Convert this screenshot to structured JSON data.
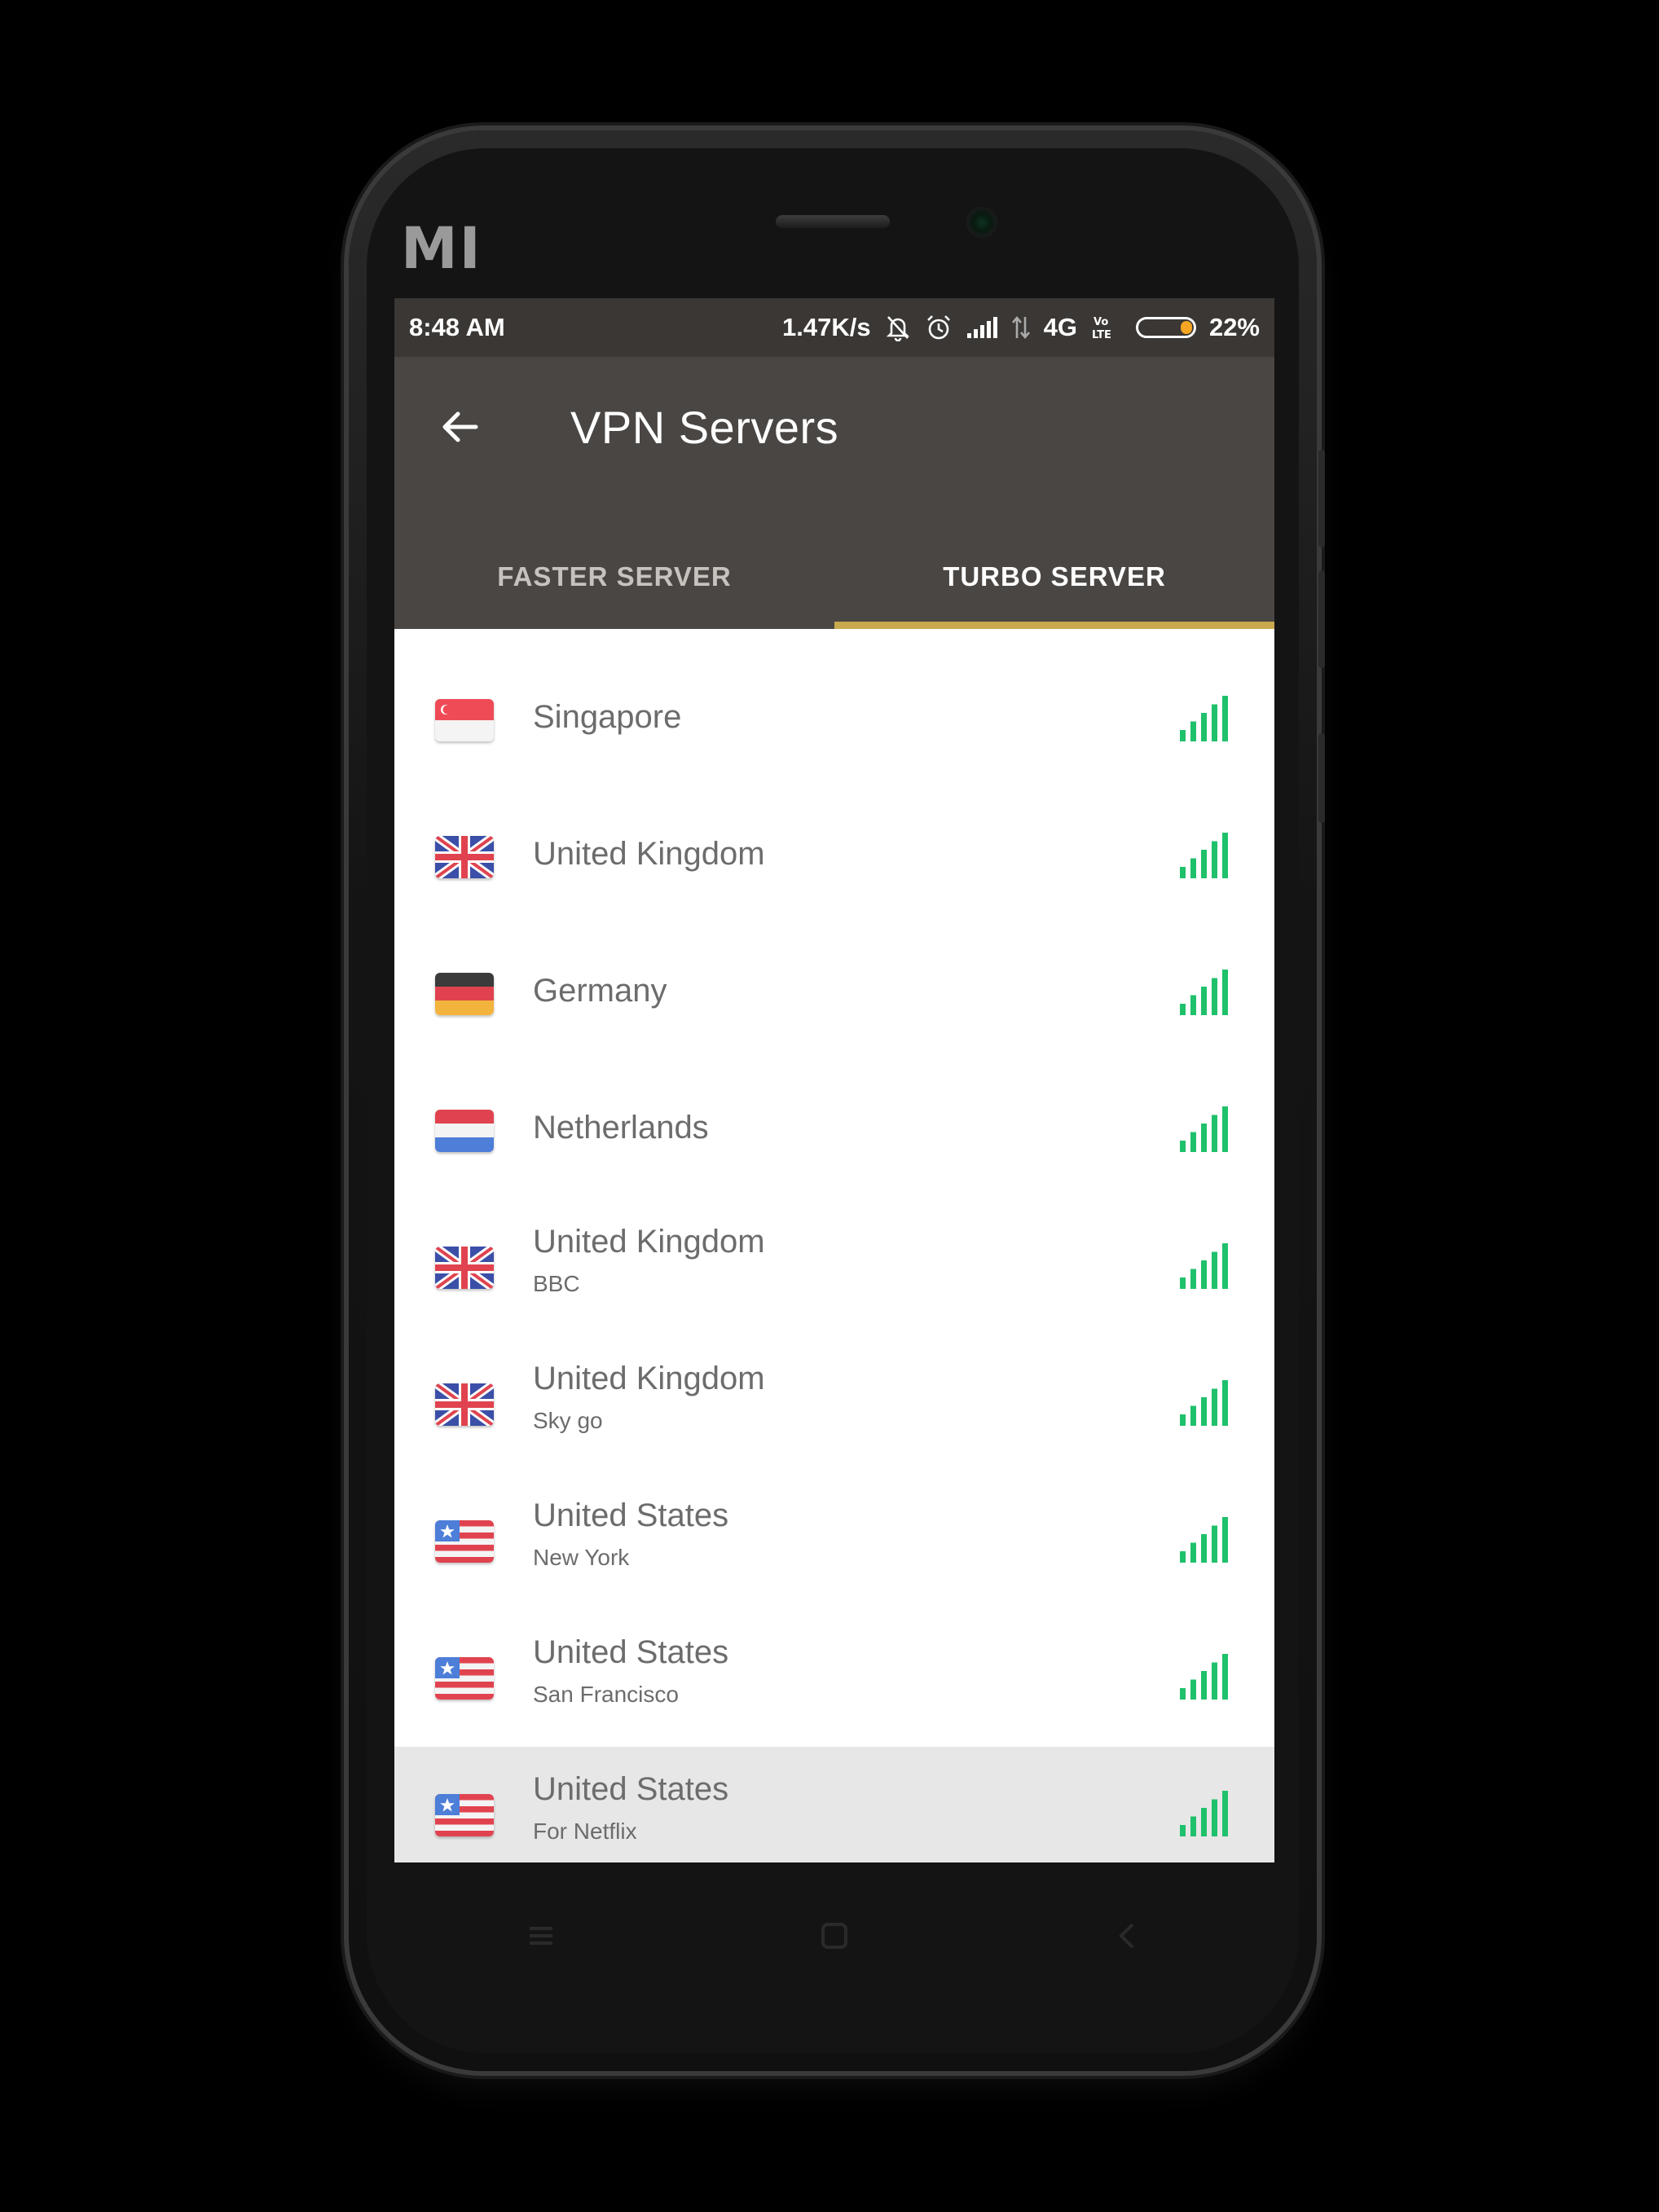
{
  "status_bar": {
    "time": "8:48 AM",
    "net_speed": "1.47K/s",
    "network_type": "4G",
    "battery_percent": "22%",
    "battery_level": 0.22,
    "icons": [
      "bell-off-icon",
      "alarm-icon",
      "signal-icon",
      "data-arrows-icon",
      "volte-icon",
      "battery-icon"
    ]
  },
  "app_bar": {
    "title": "VPN Servers",
    "back_icon": "arrow-left-icon"
  },
  "tabs": [
    {
      "label": "FASTER SERVER",
      "active": false
    },
    {
      "label": "TURBO SERVER",
      "active": true
    }
  ],
  "colors": {
    "app_bar": "#4a4643",
    "tab_indicator": "#c9a94e",
    "signal": "#1fc16b",
    "selected_row": "#e7e7e7"
  },
  "servers": [
    {
      "country": "Singapore",
      "location": "",
      "flag": "sg-flag-icon",
      "signal_bars": 5,
      "selected": false
    },
    {
      "country": "United Kingdom",
      "location": "",
      "flag": "uk-flag-icon",
      "signal_bars": 5,
      "selected": false
    },
    {
      "country": "Germany",
      "location": "",
      "flag": "de-flag-icon",
      "signal_bars": 5,
      "selected": false
    },
    {
      "country": "Netherlands",
      "location": "",
      "flag": "nl-flag-icon",
      "signal_bars": 5,
      "selected": false
    },
    {
      "country": "United Kingdom",
      "location": "BBC",
      "flag": "uk-flag-icon",
      "signal_bars": 5,
      "selected": false
    },
    {
      "country": "United Kingdom",
      "location": "Sky go",
      "flag": "uk-flag-icon",
      "signal_bars": 5,
      "selected": false
    },
    {
      "country": "United States",
      "location": "New York",
      "flag": "us-flag-icon",
      "signal_bars": 5,
      "selected": false
    },
    {
      "country": "United States",
      "location": "San Francisco",
      "flag": "us-flag-icon",
      "signal_bars": 5,
      "selected": false
    },
    {
      "country": "United States",
      "location": "For Netflix",
      "flag": "us-flag-icon",
      "signal_bars": 5,
      "selected": true
    }
  ],
  "nav": [
    "menu-icon",
    "home-icon",
    "back-icon"
  ]
}
